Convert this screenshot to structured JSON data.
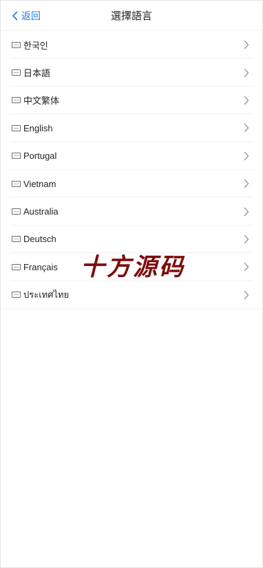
{
  "header": {
    "back_label": "返回",
    "title": "選擇語言"
  },
  "languages": [
    {
      "label": "한국인"
    },
    {
      "label": "日本語"
    },
    {
      "label": "中文繁体"
    },
    {
      "label": "English"
    },
    {
      "label": "Portugal"
    },
    {
      "label": "Vietnam"
    },
    {
      "label": "Australia"
    },
    {
      "label": "Deutsch"
    },
    {
      "label": "Français"
    },
    {
      "label": "ประเทศไทย"
    }
  ],
  "watermark": {
    "text": "十方源码"
  },
  "colors": {
    "accent": "#1a7ee6",
    "watermark": "#7d0c0c",
    "chevron": "#9a9a9a",
    "divider": "#f1f1f1"
  }
}
